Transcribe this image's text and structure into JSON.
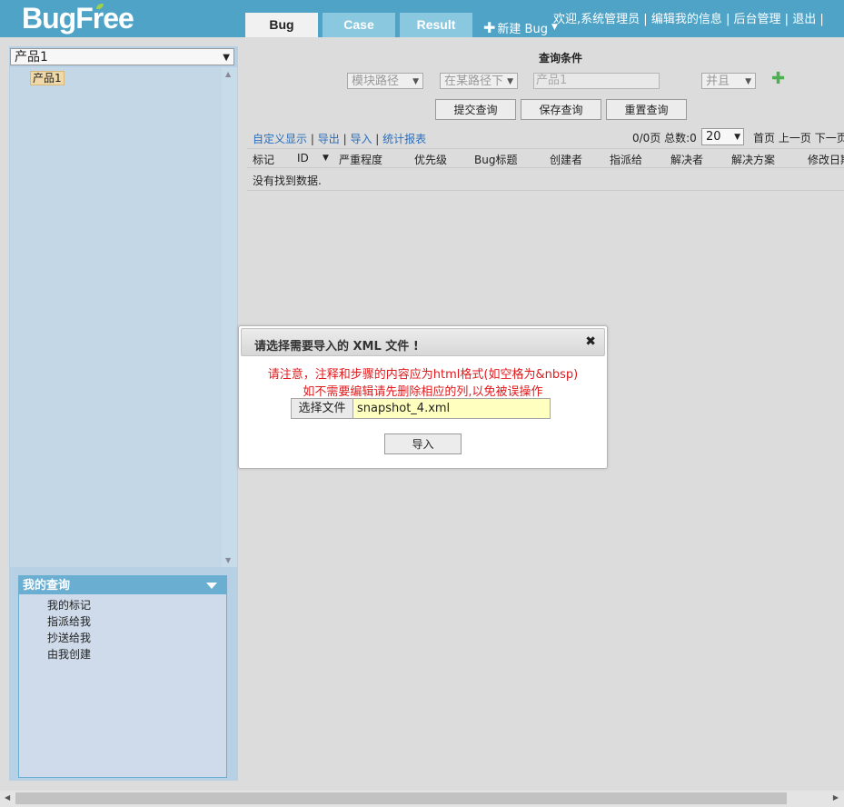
{
  "header": {
    "logo": "BugFree",
    "tabs": [
      {
        "label": "Bug"
      },
      {
        "label": "Case"
      },
      {
        "label": "Result"
      }
    ],
    "new_bug": "新建 Bug",
    "welcome": "欢迎,系统管理员",
    "edit_info": "编辑我的信息",
    "admin": "后台管理",
    "logout": "退出",
    "sep": "|"
  },
  "sidebar": {
    "product_select": "产品1",
    "tree_item": "产品1",
    "my_query": {
      "title": "我的查询",
      "items": [
        {
          "label": "我的标记"
        },
        {
          "label": "指派给我"
        },
        {
          "label": "抄送给我"
        },
        {
          "label": "由我创建"
        }
      ]
    }
  },
  "query": {
    "title": "查询条件",
    "field": "模块路径",
    "operator": "在某路径下",
    "value": "产品1",
    "logic": "并且",
    "submit": "提交查询",
    "save": "保存查询",
    "reset": "重置查询"
  },
  "toolbar": {
    "custom_display": "自定义显示",
    "export": "导出",
    "import": "导入",
    "report": "统计报表",
    "sep": "|",
    "page_info": "0/0页 总数:0",
    "page_size": "20",
    "first": "首页",
    "prev": "上一页",
    "next": "下一页"
  },
  "table": {
    "columns": [
      {
        "label": "标记"
      },
      {
        "label": "ID"
      },
      {
        "label": "严重程度"
      },
      {
        "label": "优先级"
      },
      {
        "label": "Bug标题"
      },
      {
        "label": "创建者"
      },
      {
        "label": "指派给"
      },
      {
        "label": "解决者"
      },
      {
        "label": "解决方案"
      },
      {
        "label": "修改日期"
      }
    ],
    "sort_arrow": "▼",
    "empty": "没有找到数据."
  },
  "dialog": {
    "title": "请选择需要导入的 XML 文件 !",
    "close": "✖",
    "note1": "请注意，注释和步骤的内容应为html格式(如空格为&nbsp)",
    "note2": "如不需要编辑请先删除相应的列,以免被误操作",
    "choose_file": "选择文件",
    "file_name": "snapshot_4.xml",
    "import_button": "导入"
  },
  "colors": {
    "header": "#4fa3c7",
    "link": "#2a6ebb",
    "warning": "#e0191c",
    "add": "#4caf50"
  }
}
